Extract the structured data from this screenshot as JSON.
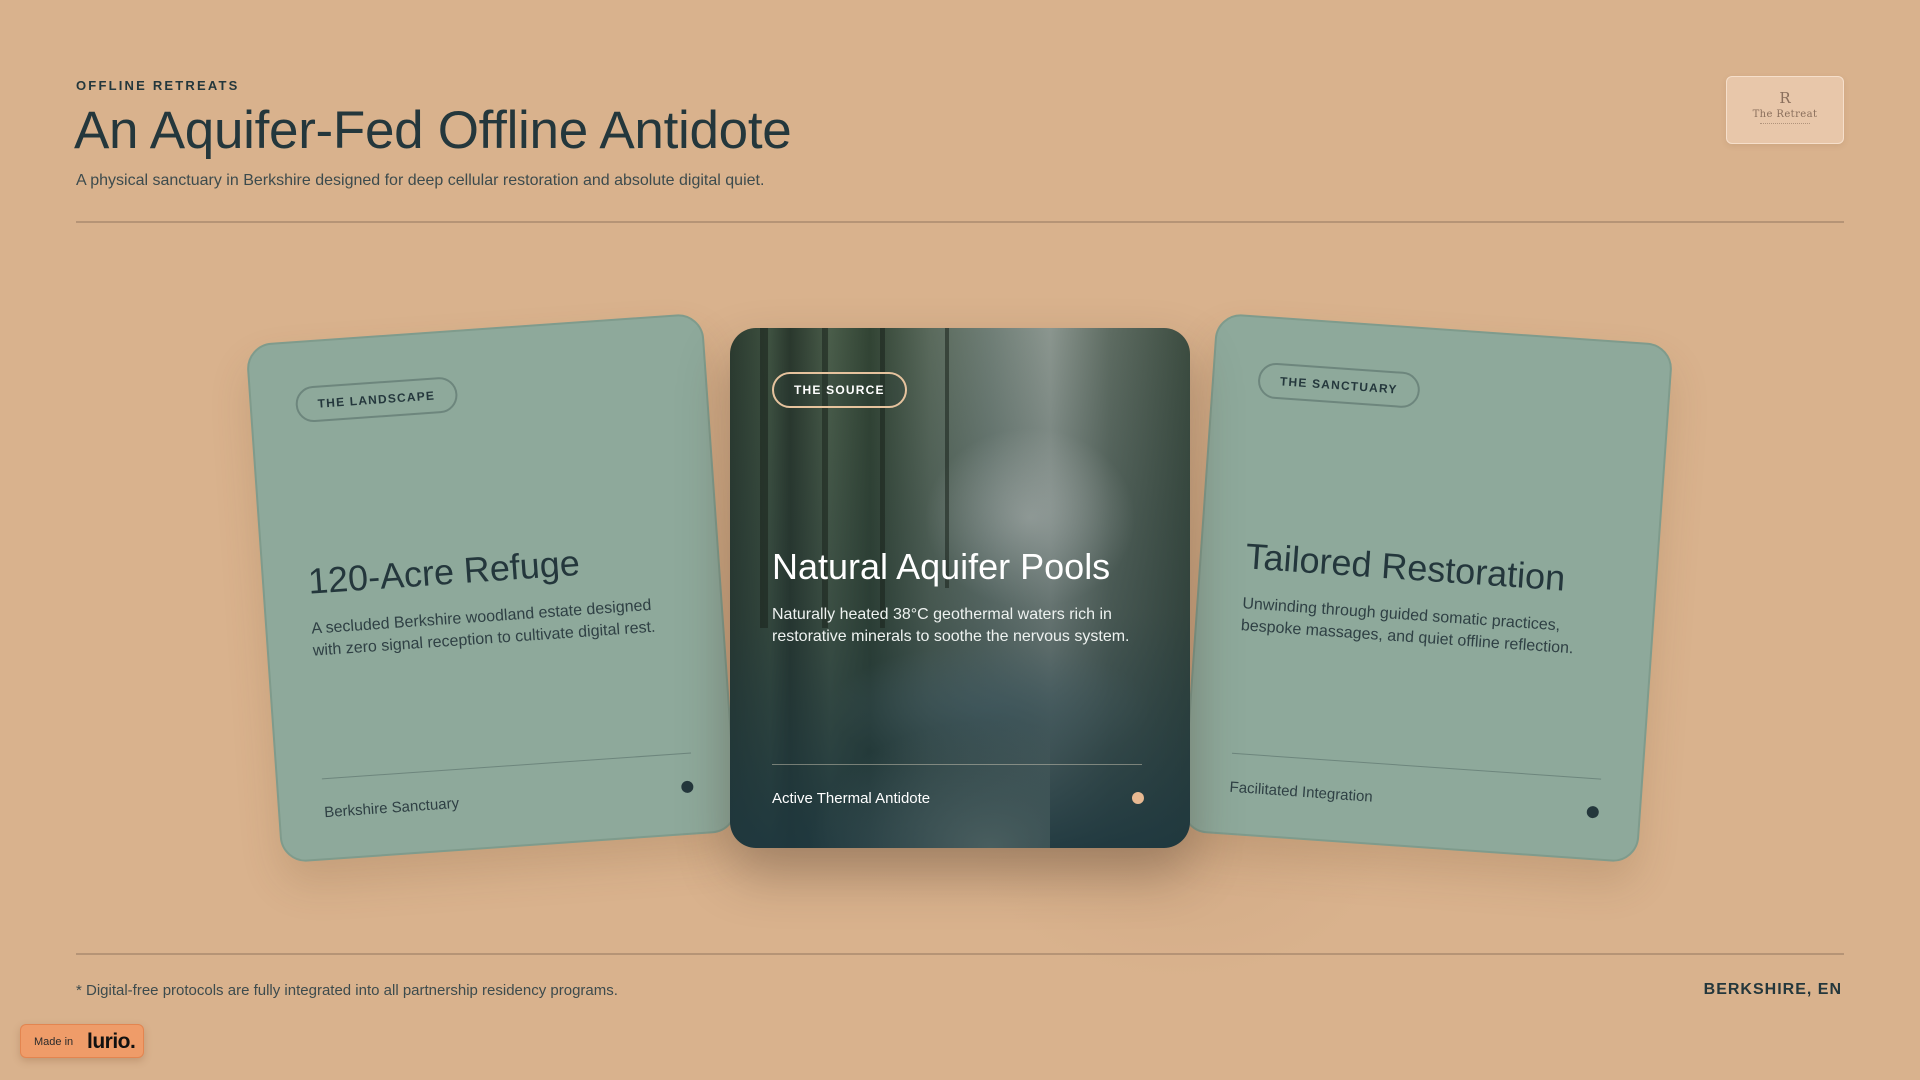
{
  "header": {
    "eyebrow": "OFFLINE RETREATS",
    "title": "An Aquifer-Fed Offline Antidote",
    "subtitle": "A physical sanctuary in Berkshire designed for deep cellular restoration and absolute digital quiet.",
    "logo": {
      "monogram": "R",
      "wordmark": "The Retreat"
    }
  },
  "cards": [
    {
      "tag": "THE LANDSCAPE",
      "title": "120-Acre Refuge",
      "description": "A secluded Berkshire woodland estate designed with zero signal reception to cultivate digital rest.",
      "footer": "Berkshire Sanctuary"
    },
    {
      "tag": "THE SOURCE",
      "title": "Natural Aquifer Pools",
      "description": "Naturally heated 38°C geothermal waters rich in restorative minerals to soothe the nervous system.",
      "footer": "Active Thermal Antidote"
    },
    {
      "tag": "THE SANCTUARY",
      "title": "Tailored Restoration",
      "description": "Unwinding through guided somatic practices, bespoke massages, and quiet offline reflection.",
      "footer": "Facilitated Integration"
    }
  ],
  "footer": {
    "note": "* Digital-free protocols are fully integrated into all partnership residency programs.",
    "location": "BERKSHIRE, EN"
  },
  "badge": {
    "made_in": "Made in",
    "brand": "lurio."
  },
  "colors": {
    "background": "#d9b28d",
    "ink": "#24373c",
    "card_sage": "#8ea99b",
    "accent_dot": "#e8b992",
    "badge": "#ef9c69"
  },
  "icons": [
    "logo-monogram-icon",
    "status-dot-icon"
  ]
}
